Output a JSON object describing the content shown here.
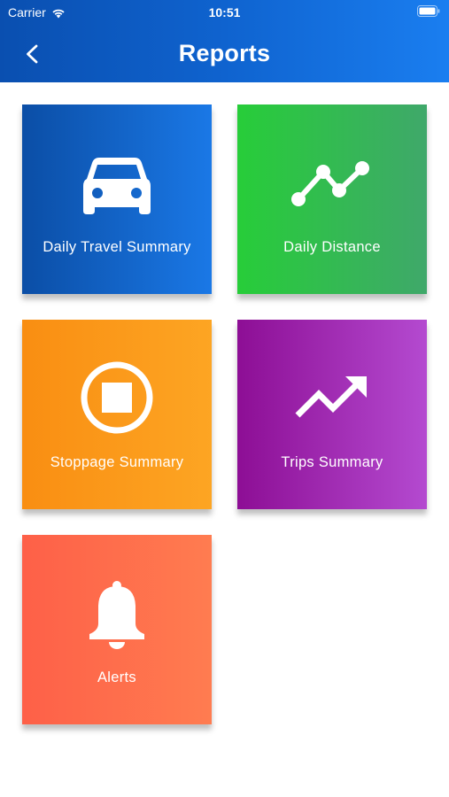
{
  "status_bar": {
    "carrier": "Carrier",
    "time": "10:51"
  },
  "header": {
    "title": "Reports",
    "back_icon": "chevron-left-icon"
  },
  "tiles": [
    {
      "label": "Daily Travel Summary",
      "icon": "car-icon",
      "color_from": "#0b4ea6",
      "color_to": "#1a78e6"
    },
    {
      "label": "Daily Distance",
      "icon": "line-graph-icon",
      "color_from": "#27cd39",
      "color_to": "#3fa86a"
    },
    {
      "label": "Stoppage Summary",
      "icon": "stop-circle-icon",
      "color_from": "#f98e12",
      "color_to": "#fda523"
    },
    {
      "label": "Trips Summary",
      "icon": "trending-up-icon",
      "color_from": "#8d0e95",
      "color_to": "#b44ad0"
    },
    {
      "label": "Alerts",
      "icon": "bell-icon",
      "color_from": "#fe6048",
      "color_to": "#ff7c50"
    }
  ],
  "colors": {
    "header_from": "#0a4fb0",
    "header_to": "#1a7ef0",
    "background": "#ffffff"
  }
}
